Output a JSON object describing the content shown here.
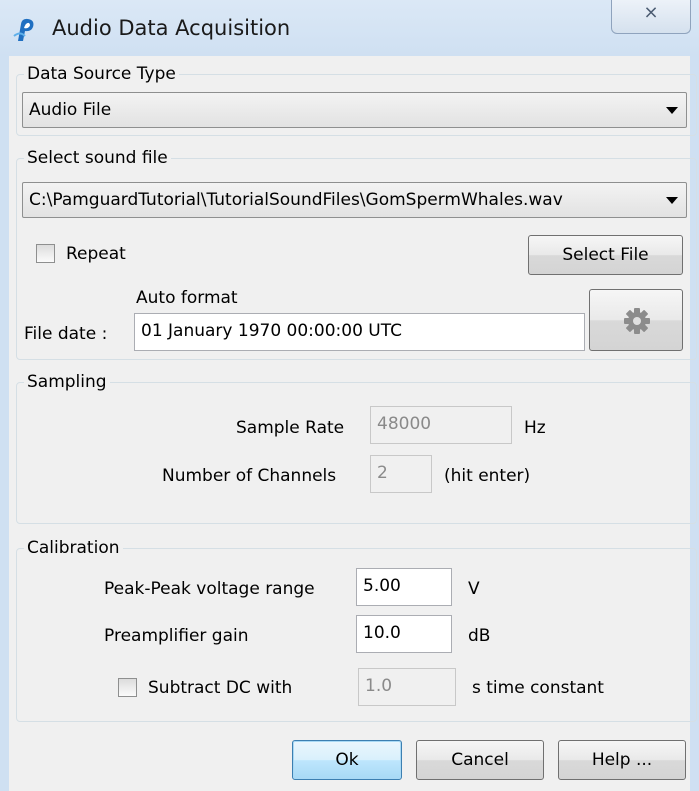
{
  "window": {
    "title": "Audio Data Acquisition",
    "close_glyph": "⨯"
  },
  "data_source": {
    "group_label": "Data Source Type",
    "selected": "Audio File"
  },
  "sound_file": {
    "group_label": "Select sound file",
    "path": "C:\\PamguardTutorial\\TutorialSoundFiles\\GomSpermWhales.wav",
    "repeat_label": "Repeat",
    "repeat_checked": false,
    "select_file_label": "Select File",
    "auto_format_label": "Auto format",
    "file_date_label": "File date :",
    "file_date_value": "01 January 1970 00:00:00 UTC",
    "settings_icon": "gear-icon"
  },
  "sampling": {
    "group_label": "Sampling",
    "sample_rate_label": "Sample Rate",
    "sample_rate_value": "48000",
    "sample_rate_unit": "Hz",
    "channels_label": "Number of Channels",
    "channels_value": "2",
    "channels_hint": "(hit enter)"
  },
  "calibration": {
    "group_label": "Calibration",
    "pp_voltage_label": "Peak-Peak voltage range",
    "pp_voltage_value": "5.00",
    "pp_voltage_unit": "V",
    "preamp_label": "Preamplifier gain",
    "preamp_value": "10.0",
    "preamp_unit": "dB",
    "subtract_dc_label": "Subtract DC with",
    "subtract_dc_checked": false,
    "dc_value": "1.0",
    "dc_unit": "s time constant"
  },
  "buttons": {
    "ok": "Ok",
    "cancel": "Cancel",
    "help": "Help ..."
  },
  "colors": {
    "accent": "#3c7fb1",
    "titlebar": "#cfe0f2",
    "panel": "#f0f0f0",
    "app_icon": "#1f6fc1"
  }
}
